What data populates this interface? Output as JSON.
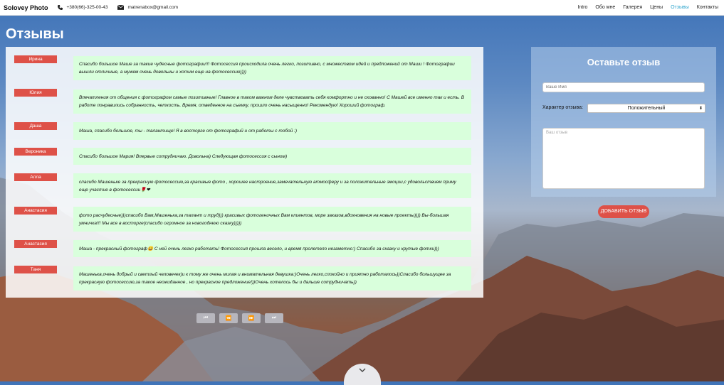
{
  "header": {
    "brand": "Solovey Photo",
    "phone": "+380(66)-325-00-43",
    "email": "matrenabox@gmail.com",
    "nav": [
      "Intro",
      "Обо мне",
      "Галерея",
      "Цены",
      "Отзывы",
      "Контакты"
    ],
    "active_nav": "Отзывы",
    "accent_color": "#2aa3cc"
  },
  "page": {
    "title": "Отзывы"
  },
  "reviews": [
    {
      "name": "Ирина",
      "text": "Спасибо большое Маше за такие чудесные фотографии!!! Фотосессия происходила очень легко, позитивно, с множеством идей и предложений от Маши ! Фотографии вышли отличные, а мужем очень довольны и хотим еще на фотосессию))))"
    },
    {
      "name": "Юлия",
      "text": "Впечатления от общения с фотографом самые позитивные! Главное в таком важном деле чувствовать себя комфортно и не скованно! С Машей все именно так и есть. В работе понравились собранность, четкость. Время, отведенное на съемку, прошло очень насыщенно! Рекомендую! Хороший фотограф."
    },
    {
      "name": "Даша",
      "text": "Маша, спасибо большое, ты - талантище! Я в восторге от фотографий и от работы с тобой :)"
    },
    {
      "name": "Вероника",
      "text": "Спасибо большое Мария! Впервые сотрудничаю. Довольна) Следующая фотосессия с сыном)"
    },
    {
      "name": "Алла",
      "text": "спасибо Машеньке за прекрасную фотосессию,за красивые фото , хорошее настроение,замечательную атмосферу и за положительные эмоции,с удовольствием приму еще участие в фотосессии🌹❤"
    },
    {
      "name": "Анастасия",
      "text": "фото расчудесные)))спасибо Вам,Машенька,за талант и труд))) красивых фотогеничных Вам клиентов, море заказов,вдохновения на новые проекты)))) Вы-большая умничка!!! Мы все в восторге(спасибо огромное за новогоднюю сказку)))))"
    },
    {
      "name": "Анастасия",
      "text": "Маша - прекрасный фотограф😀 С ней очень легко работать! Фотосессия прошла весело, и время пролетело незаметно:) Спасибо за сказку и крутые фотки)))"
    },
    {
      "name": "Таня",
      "text": "Машенька,очень добрый и светлый человечек)и к тому же очень милая и внимательная девушка:)Очень легко,спокойно и приятно работалось))Спасибо большущее за прекрасную фотосессию,за такое неожиданное , но прекрасное предложение!))Очень хотелось бы и дальше сотрудничать))"
    }
  ],
  "pager": [
    {
      "icon": "first-page-icon",
      "glyph": "⏮"
    },
    {
      "icon": "prev-page-icon",
      "glyph": "⏪"
    },
    {
      "icon": "next-page-icon",
      "glyph": "⏩"
    },
    {
      "icon": "last-page-icon",
      "glyph": "⏭"
    }
  ],
  "form": {
    "title": "Оставьте отзыв",
    "name_placeholder": "Ваше Имя",
    "type_label": "Характер отзыва:",
    "type_value": "Положительный",
    "review_placeholder": "Ваш отзыв",
    "submit_label": "ДОБАВИТЬ ОТЗЫВ",
    "button_color": "#de5148"
  },
  "colors": {
    "name_tag": "#de5148",
    "bubble": "#d9ffdc"
  }
}
